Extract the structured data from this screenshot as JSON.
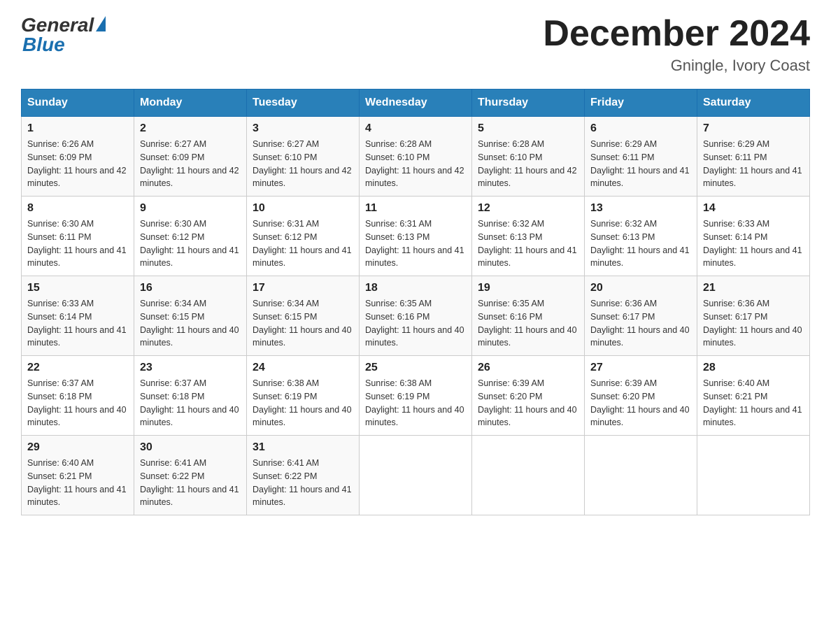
{
  "header": {
    "logo_general": "General",
    "logo_blue": "Blue",
    "title": "December 2024",
    "location": "Gningle, Ivory Coast"
  },
  "days_of_week": [
    "Sunday",
    "Monday",
    "Tuesday",
    "Wednesday",
    "Thursday",
    "Friday",
    "Saturday"
  ],
  "weeks": [
    [
      {
        "day": "1",
        "sunrise": "6:26 AM",
        "sunset": "6:09 PM",
        "daylight": "11 hours and 42 minutes."
      },
      {
        "day": "2",
        "sunrise": "6:27 AM",
        "sunset": "6:09 PM",
        "daylight": "11 hours and 42 minutes."
      },
      {
        "day": "3",
        "sunrise": "6:27 AM",
        "sunset": "6:10 PM",
        "daylight": "11 hours and 42 minutes."
      },
      {
        "day": "4",
        "sunrise": "6:28 AM",
        "sunset": "6:10 PM",
        "daylight": "11 hours and 42 minutes."
      },
      {
        "day": "5",
        "sunrise": "6:28 AM",
        "sunset": "6:10 PM",
        "daylight": "11 hours and 42 minutes."
      },
      {
        "day": "6",
        "sunrise": "6:29 AM",
        "sunset": "6:11 PM",
        "daylight": "11 hours and 41 minutes."
      },
      {
        "day": "7",
        "sunrise": "6:29 AM",
        "sunset": "6:11 PM",
        "daylight": "11 hours and 41 minutes."
      }
    ],
    [
      {
        "day": "8",
        "sunrise": "6:30 AM",
        "sunset": "6:11 PM",
        "daylight": "11 hours and 41 minutes."
      },
      {
        "day": "9",
        "sunrise": "6:30 AM",
        "sunset": "6:12 PM",
        "daylight": "11 hours and 41 minutes."
      },
      {
        "day": "10",
        "sunrise": "6:31 AM",
        "sunset": "6:12 PM",
        "daylight": "11 hours and 41 minutes."
      },
      {
        "day": "11",
        "sunrise": "6:31 AM",
        "sunset": "6:13 PM",
        "daylight": "11 hours and 41 minutes."
      },
      {
        "day": "12",
        "sunrise": "6:32 AM",
        "sunset": "6:13 PM",
        "daylight": "11 hours and 41 minutes."
      },
      {
        "day": "13",
        "sunrise": "6:32 AM",
        "sunset": "6:13 PM",
        "daylight": "11 hours and 41 minutes."
      },
      {
        "day": "14",
        "sunrise": "6:33 AM",
        "sunset": "6:14 PM",
        "daylight": "11 hours and 41 minutes."
      }
    ],
    [
      {
        "day": "15",
        "sunrise": "6:33 AM",
        "sunset": "6:14 PM",
        "daylight": "11 hours and 41 minutes."
      },
      {
        "day": "16",
        "sunrise": "6:34 AM",
        "sunset": "6:15 PM",
        "daylight": "11 hours and 40 minutes."
      },
      {
        "day": "17",
        "sunrise": "6:34 AM",
        "sunset": "6:15 PM",
        "daylight": "11 hours and 40 minutes."
      },
      {
        "day": "18",
        "sunrise": "6:35 AM",
        "sunset": "6:16 PM",
        "daylight": "11 hours and 40 minutes."
      },
      {
        "day": "19",
        "sunrise": "6:35 AM",
        "sunset": "6:16 PM",
        "daylight": "11 hours and 40 minutes."
      },
      {
        "day": "20",
        "sunrise": "6:36 AM",
        "sunset": "6:17 PM",
        "daylight": "11 hours and 40 minutes."
      },
      {
        "day": "21",
        "sunrise": "6:36 AM",
        "sunset": "6:17 PM",
        "daylight": "11 hours and 40 minutes."
      }
    ],
    [
      {
        "day": "22",
        "sunrise": "6:37 AM",
        "sunset": "6:18 PM",
        "daylight": "11 hours and 40 minutes."
      },
      {
        "day": "23",
        "sunrise": "6:37 AM",
        "sunset": "6:18 PM",
        "daylight": "11 hours and 40 minutes."
      },
      {
        "day": "24",
        "sunrise": "6:38 AM",
        "sunset": "6:19 PM",
        "daylight": "11 hours and 40 minutes."
      },
      {
        "day": "25",
        "sunrise": "6:38 AM",
        "sunset": "6:19 PM",
        "daylight": "11 hours and 40 minutes."
      },
      {
        "day": "26",
        "sunrise": "6:39 AM",
        "sunset": "6:20 PM",
        "daylight": "11 hours and 40 minutes."
      },
      {
        "day": "27",
        "sunrise": "6:39 AM",
        "sunset": "6:20 PM",
        "daylight": "11 hours and 40 minutes."
      },
      {
        "day": "28",
        "sunrise": "6:40 AM",
        "sunset": "6:21 PM",
        "daylight": "11 hours and 41 minutes."
      }
    ],
    [
      {
        "day": "29",
        "sunrise": "6:40 AM",
        "sunset": "6:21 PM",
        "daylight": "11 hours and 41 minutes."
      },
      {
        "day": "30",
        "sunrise": "6:41 AM",
        "sunset": "6:22 PM",
        "daylight": "11 hours and 41 minutes."
      },
      {
        "day": "31",
        "sunrise": "6:41 AM",
        "sunset": "6:22 PM",
        "daylight": "11 hours and 41 minutes."
      },
      null,
      null,
      null,
      null
    ]
  ]
}
